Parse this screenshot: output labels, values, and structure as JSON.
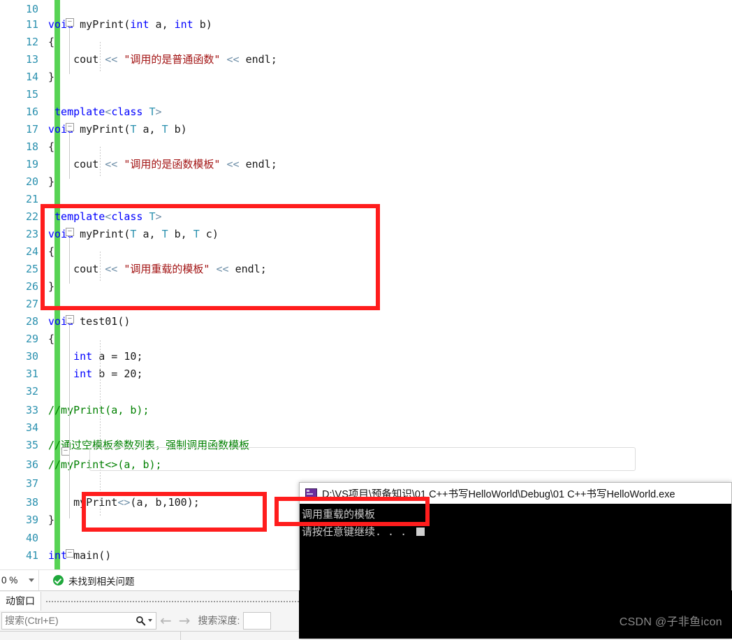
{
  "editor": {
    "gutter_color": "#2B91AF",
    "change_bar_color": "#57D354",
    "lines": [
      {
        "num": "10",
        "text": ""
      },
      {
        "num": "11",
        "text": "void myPrint(int a, int b)"
      },
      {
        "num": "12",
        "text": "{"
      },
      {
        "num": "13",
        "text": "    cout << \"调用的是普通函数\" << endl;"
      },
      {
        "num": "14",
        "text": "}"
      },
      {
        "num": "15",
        "text": ""
      },
      {
        "num": "16",
        "text": " template<class T>"
      },
      {
        "num": "17",
        "text": "void myPrint(T a, T b)"
      },
      {
        "num": "18",
        "text": "{"
      },
      {
        "num": "19",
        "text": "    cout << \"调用的是函数模板\" << endl;"
      },
      {
        "num": "20",
        "text": "}"
      },
      {
        "num": "21",
        "text": ""
      },
      {
        "num": "22",
        "text": " template<class T>"
      },
      {
        "num": "23",
        "text": "void myPrint(T a, T b, T c)"
      },
      {
        "num": "24",
        "text": "{"
      },
      {
        "num": "25",
        "text": "    cout << \"调用重载的模板\" << endl;"
      },
      {
        "num": "26",
        "text": "}"
      },
      {
        "num": "27",
        "text": ""
      },
      {
        "num": "28",
        "text": "void test01()"
      },
      {
        "num": "29",
        "text": "{"
      },
      {
        "num": "30",
        "text": "    int a = 10;"
      },
      {
        "num": "31",
        "text": "    int b = 20;"
      },
      {
        "num": "32",
        "text": ""
      },
      {
        "num": "33",
        "text": "    //myPrint(a, b);"
      },
      {
        "num": "34",
        "text": ""
      },
      {
        "num": "35",
        "text": "    //通过空模板参数列表，强制调用函数模板"
      },
      {
        "num": "36",
        "text": "    //myPrint<>(a, b);"
      },
      {
        "num": "37",
        "text": ""
      },
      {
        "num": "38",
        "text": "    myPrint<>(a, b,100);"
      },
      {
        "num": "39",
        "text": "}"
      },
      {
        "num": "40",
        "text": ""
      },
      {
        "num": "41",
        "text": "int main()"
      }
    ],
    "tokens": {
      "keyword_void": "void",
      "keyword_int": "int",
      "keyword_template": "template",
      "keyword_class": "class",
      "type_T": "T",
      "fn_myPrint": "myPrint",
      "fn_test01": "test01",
      "fn_main": "main",
      "stream_cout": "cout",
      "stream_endl": "endl",
      "op_insert": "<<",
      "str_normal_fn": "\"调用的是普通函数\"",
      "str_fn_template": "\"调用的是函数模板\"",
      "str_overload_template": "\"调用重载的模板\"",
      "cmt_call": "//myPrint(a, b);",
      "cmt_note": "//通过空模板参数列表，强制调用函数模板",
      "cmt_empty_list": "//myPrint<>(a, b);"
    }
  },
  "annotations": {
    "box_color": "#FF1D1D",
    "boxes": [
      {
        "name": "overload-template-definition"
      },
      {
        "name": "myprint-call-line38"
      },
      {
        "name": "console-output-line"
      }
    ]
  },
  "console": {
    "title": "D:\\VS项目\\预备知识\\01 C++书写HelloWorld\\Debug\\01 C++书写HelloWorld.exe",
    "icon": "console-app-icon",
    "lines": [
      "调用重载的模板",
      "请按任意键继续. . ."
    ],
    "background": "#000000",
    "text_color": "#c8c8c8"
  },
  "statusbar": {
    "zoom": "0 %",
    "zoom_dropdown_icon": "chevron-down-icon",
    "error_icon": "check-circle-icon",
    "error_text": "未找到相关问题"
  },
  "autos_pane": {
    "tab_label": "动窗口",
    "search_placeholder": "搜索(Ctrl+E)",
    "search_icon": "search-icon",
    "search_dropdown_icon": "chevron-down-icon",
    "back_icon": "arrow-left-icon",
    "forward_icon": "arrow-right-icon",
    "depth_label": "搜索深度:",
    "depth_value": ""
  },
  "watermark": {
    "text": "CSDN @子非鱼icon"
  }
}
